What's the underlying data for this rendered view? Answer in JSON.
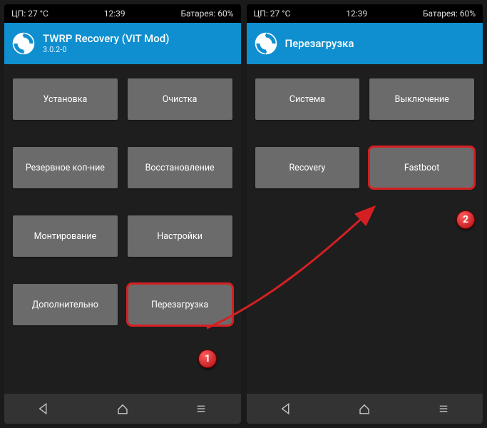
{
  "left": {
    "status": {
      "temp": "ЦП: 27 °C",
      "time": "12:39",
      "battery": "Батарея: 60%"
    },
    "header": {
      "title": "TWRP Recovery (ViT Mod)",
      "version": "3.0.2-0"
    },
    "buttons": [
      "Установка",
      "Очистка",
      "Резервное коп-ние",
      "Восстановление",
      "Монтирование",
      "Настройки",
      "Дополнительно",
      "Перезагрузка"
    ]
  },
  "right": {
    "status": {
      "temp": "ЦП: 27 °C",
      "time": "12:39",
      "battery": "Батарея: 60%"
    },
    "header": {
      "title": "Перезагрузка",
      "version": ""
    },
    "buttons": [
      "Система",
      "Выключение",
      "Recovery",
      "Fastboot"
    ]
  },
  "annotations": {
    "badge1": "1",
    "badge2": "2"
  }
}
